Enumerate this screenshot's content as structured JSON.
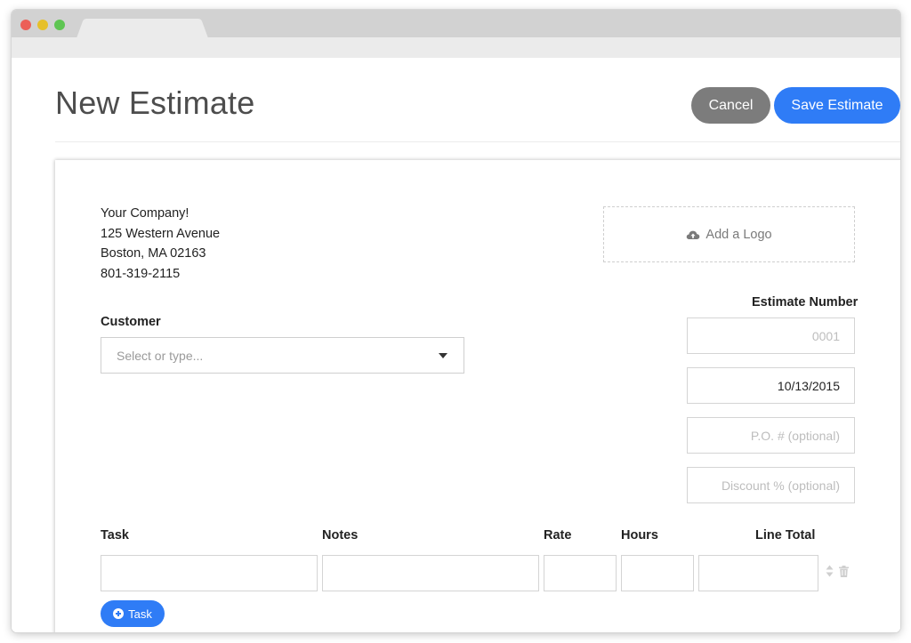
{
  "header": {
    "title": "New Estimate",
    "cancel_label": "Cancel",
    "save_label": "Save Estimate"
  },
  "company": {
    "name": "Your Company!",
    "address": "125 Western Avenue",
    "city": "Boston, MA 02163",
    "phone": "801-319-2115"
  },
  "logo": {
    "label": "Add a Logo",
    "icon": "cloud-upload-icon"
  },
  "customer": {
    "label": "Customer",
    "placeholder": "Select or type..."
  },
  "estimate": {
    "number_label": "Estimate Number",
    "number_placeholder": "0001",
    "date_value": "10/13/2015",
    "po_placeholder": "P.O. # (optional)",
    "discount_placeholder": "Discount % (optional)"
  },
  "line_items": {
    "columns": [
      "Task",
      "Notes",
      "Rate",
      "Hours",
      "Line Total"
    ],
    "add_task_label": "Task"
  },
  "colors": {
    "primary": "#2f7cf6",
    "cancel": "#7c7c7c"
  }
}
